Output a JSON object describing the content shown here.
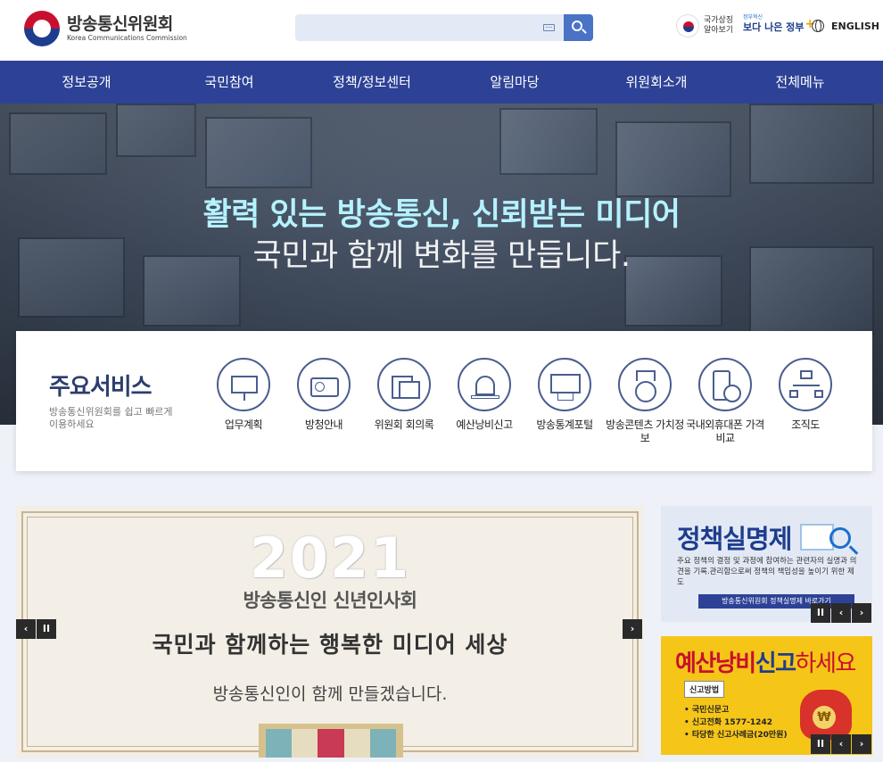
{
  "header": {
    "logo_ko": "방송통신위원회",
    "logo_en": "Korea Communications Commission",
    "search_placeholder": "",
    "symbol_line1": "국가상징",
    "symbol_line2": "알아보기",
    "gov_small": "정부혁신",
    "gov_main": "보다 나은 정부",
    "gov_plus": "+",
    "lang": "ENGLISH"
  },
  "nav": {
    "items": [
      {
        "label": "정보공개"
      },
      {
        "label": "국민참여"
      },
      {
        "label": "정책/정보센터"
      },
      {
        "label": "알림마당"
      },
      {
        "label": "위원회소개"
      },
      {
        "label": "전체메뉴"
      }
    ]
  },
  "hero": {
    "line1": "활력 있는 방송통신, 신뢰받는 미디어",
    "line2": "국민과 함께 변화를 만듭니다."
  },
  "services": {
    "title": "주요서비스",
    "subtitle": "방송통신위원회를 쉽고 빠르게 이용하세요",
    "items": [
      {
        "label": "업무계획",
        "icon": "presentation-board-icon"
      },
      {
        "label": "방청안내",
        "icon": "radio-icon"
      },
      {
        "label": "위원회 회의록",
        "icon": "folder-document-icon"
      },
      {
        "label": "예산낭비신고",
        "icon": "siren-icon"
      },
      {
        "label": "방송통계포털",
        "icon": "chart-board-icon"
      },
      {
        "label": "방송콘텐츠 가치정보",
        "icon": "medal-info-icon"
      },
      {
        "label": "국내외휴대폰 가격비교",
        "icon": "phone-won-icon"
      },
      {
        "label": "조직도",
        "icon": "org-chart-icon"
      }
    ]
  },
  "banner": {
    "year": "2021",
    "title": "방송통신인 신년인사회",
    "slogan": "국민과 함께하는 행복한 미디어 세상",
    "subtitle": "방송통신인이 함께 만들겠습니다.",
    "stripe_colors": [
      "#7db3b8",
      "#e6dcc0",
      "#c83a55",
      "#e6dcc0",
      "#7db3b8"
    ]
  },
  "side1": {
    "title": "정책실명제",
    "desc": "주요 정책의 결정 및 과정에 참여하는 관련자의 실명과 의견을 기록.관리함으로써 정책의 책임성을 높이기 위한 제도",
    "button": "방송통신위원회 정책실명제 바로가기"
  },
  "side2": {
    "title_a": "예산낭비",
    "title_b": "신고",
    "title_c": "하세요",
    "tag": "신고방법",
    "list": [
      "• 국민신문고",
      "• 신고전화 1577-1242",
      "• 타당한 신고사례금(20만원)"
    ],
    "won": "₩"
  },
  "controls": {
    "prev": "‹",
    "pause": "II",
    "next": "›"
  }
}
